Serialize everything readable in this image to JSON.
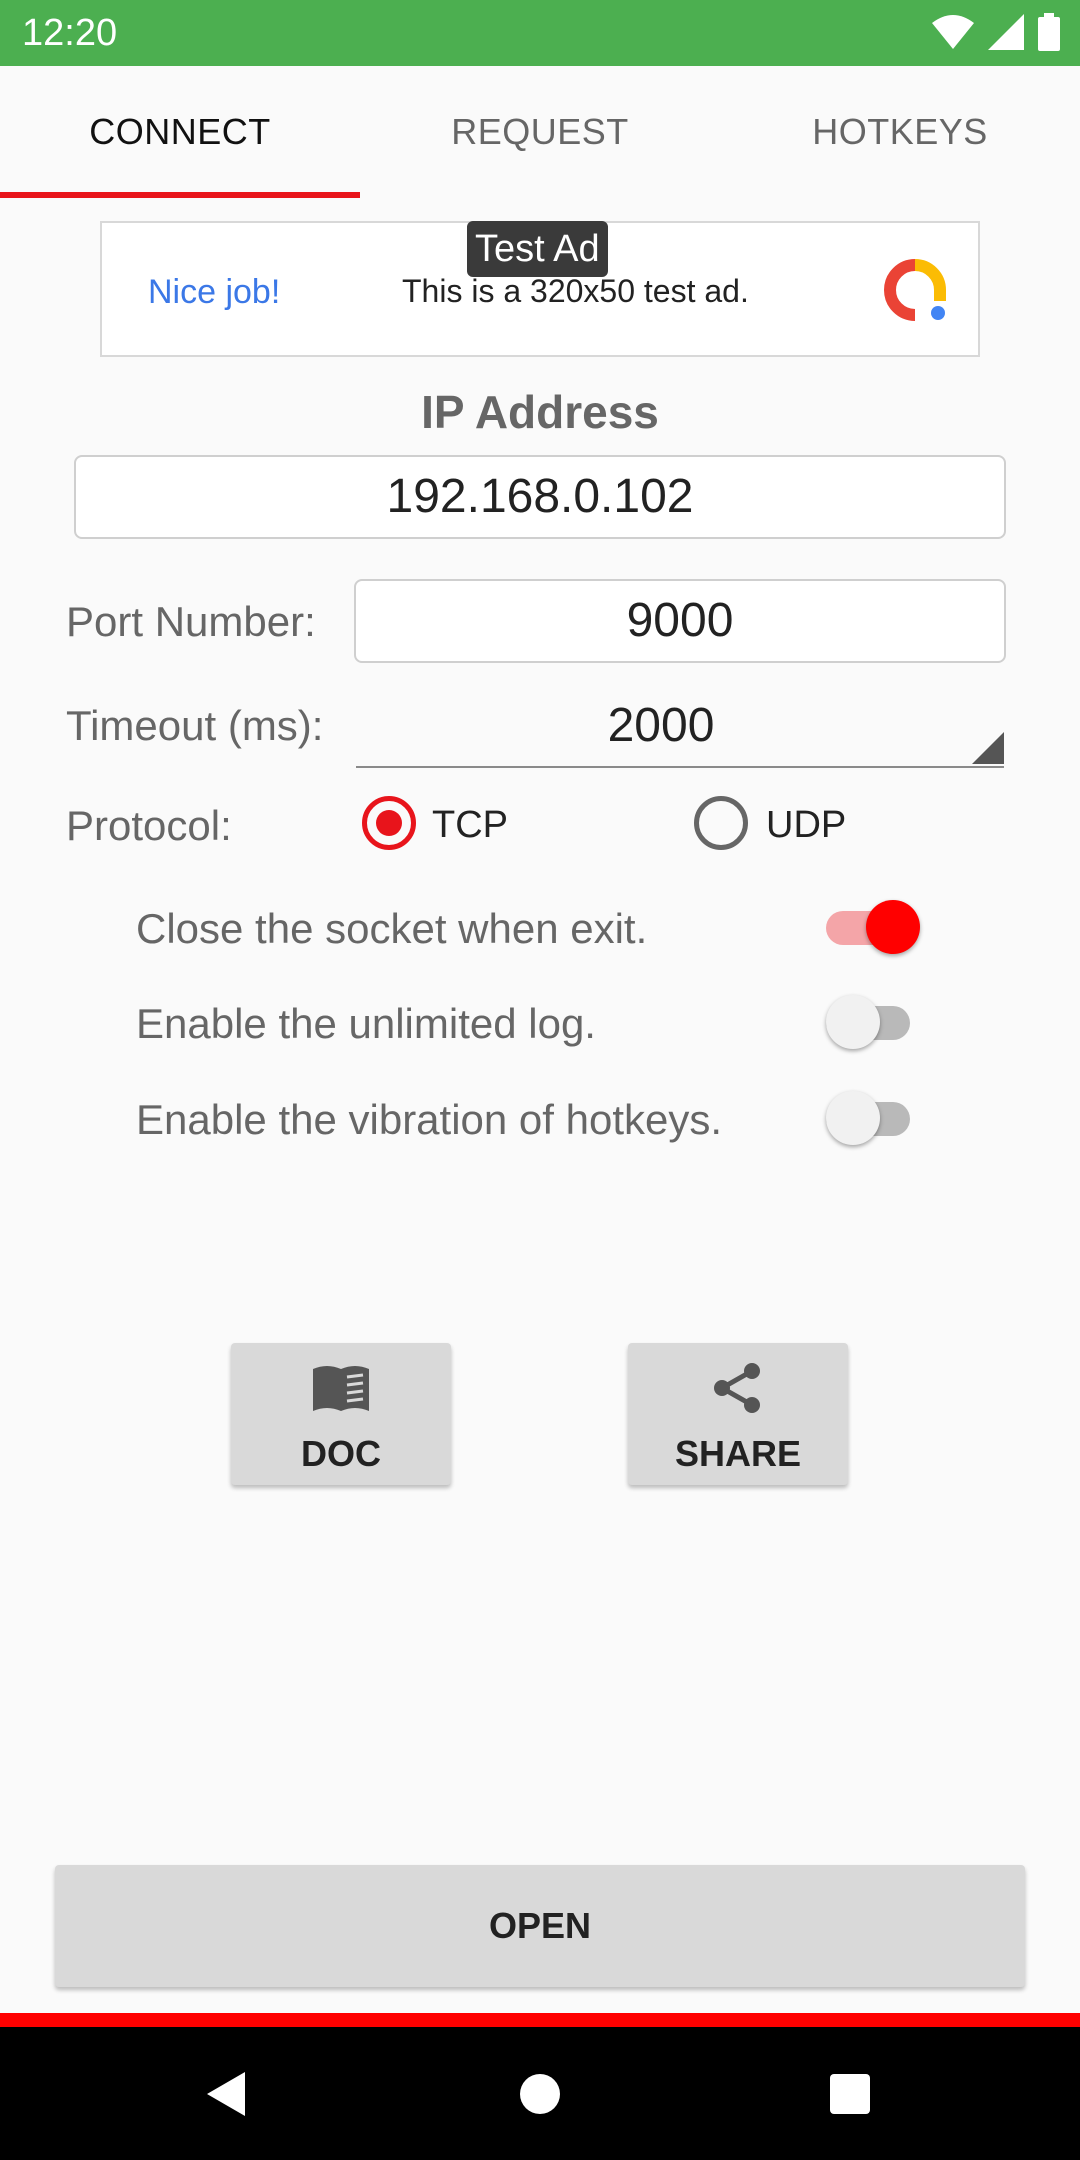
{
  "status_bar": {
    "time": "12:20"
  },
  "tabs": [
    {
      "label": "CONNECT",
      "active": true
    },
    {
      "label": "REQUEST",
      "active": false
    },
    {
      "label": "HOTKEYS",
      "active": false
    }
  ],
  "ad": {
    "label": "Test Ad",
    "headline": "Nice job!",
    "text": "This is a 320x50 test ad."
  },
  "ip": {
    "title": "IP Address",
    "value": "192.168.0.102"
  },
  "port": {
    "label": "Port Number:",
    "value": "9000"
  },
  "timeout": {
    "label": "Timeout (ms):",
    "value": "2000"
  },
  "protocol": {
    "label": "Protocol:",
    "options": [
      {
        "label": "TCP",
        "checked": true
      },
      {
        "label": "UDP",
        "checked": false
      }
    ]
  },
  "switches": [
    {
      "label": "Close the socket when exit.",
      "on": true
    },
    {
      "label": "Enable the unlimited log.",
      "on": false
    },
    {
      "label": "Enable the vibration of hotkeys.",
      "on": false
    }
  ],
  "buttons": {
    "doc": "DOC",
    "share": "SHARE",
    "open": "OPEN"
  },
  "colors": {
    "accent": "#e8141b",
    "status_bar": "#4caf50",
    "ad_link": "#3b78e7"
  }
}
